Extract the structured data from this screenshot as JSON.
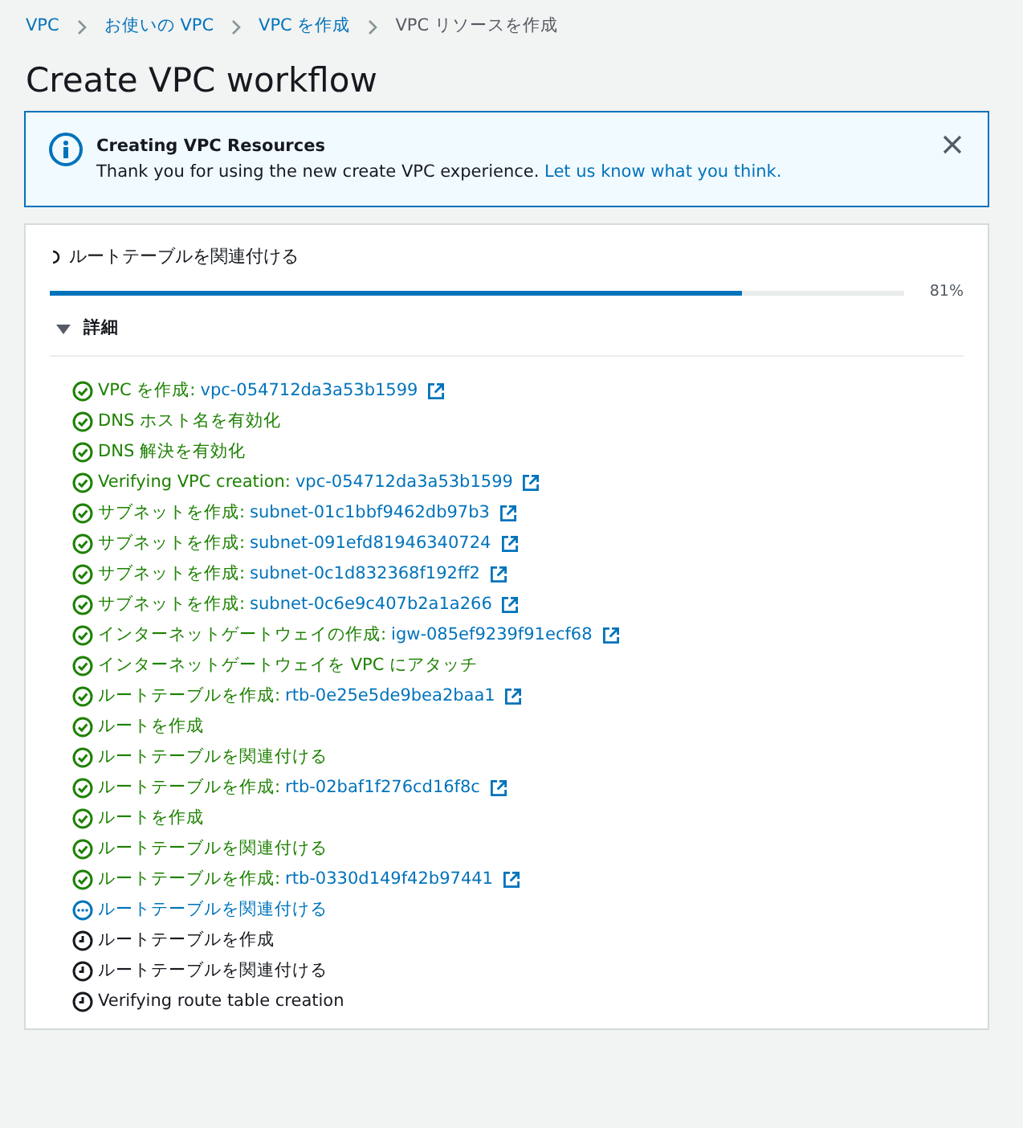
{
  "breadcrumbs": [
    {
      "label": "VPC",
      "current": false
    },
    {
      "label": "お使いの VPC",
      "current": false
    },
    {
      "label": "VPC を作成",
      "current": false
    },
    {
      "label": "VPC リソースを作成",
      "current": true
    }
  ],
  "title": "Create VPC workflow",
  "flash": {
    "title": "Creating VPC Resources",
    "message": "Thank you for using the new create VPC experience.",
    "link": "Let us know what you think."
  },
  "progress": {
    "status": "ルートテーブルを関連付ける",
    "level": 0.81,
    "reading": "81%"
  },
  "details": {
    "label": "詳細",
    "expanded": true,
    "steps": [
      {
        "kind": "success",
        "label": "VPC を作成:",
        "link": "vpc-054712da3a53b1599"
      },
      {
        "kind": "success",
        "label": "DNS ホスト名を有効化"
      },
      {
        "kind": "success",
        "label": "DNS 解決を有効化"
      },
      {
        "kind": "success",
        "label": "Verifying VPC creation:",
        "link": "vpc-054712da3a53b1599"
      },
      {
        "kind": "success",
        "label": "サブネットを作成:",
        "link": "subnet-01c1bbf9462db97b3"
      },
      {
        "kind": "success",
        "label": "サブネットを作成:",
        "link": "subnet-091efd81946340724"
      },
      {
        "kind": "success",
        "label": "サブネットを作成:",
        "link": "subnet-0c1d832368f192ff2"
      },
      {
        "kind": "success",
        "label": "サブネットを作成:",
        "link": "subnet-0c6e9c407b2a1a266"
      },
      {
        "kind": "success",
        "label": "インターネットゲートウェイの作成:",
        "link": "igw-085ef9239f91ecf68"
      },
      {
        "kind": "success",
        "label": "インターネットゲートウェイを VPC にアタッチ"
      },
      {
        "kind": "success",
        "label": "ルートテーブルを作成:",
        "link": "rtb-0e25e5de9bea2baa1"
      },
      {
        "kind": "success",
        "label": "ルートを作成"
      },
      {
        "kind": "success",
        "label": "ルートテーブルを関連付ける"
      },
      {
        "kind": "success",
        "label": "ルートテーブルを作成:",
        "link": "rtb-02baf1f276cd16f8c"
      },
      {
        "kind": "success",
        "label": "ルートを作成"
      },
      {
        "kind": "success",
        "label": "ルートテーブルを関連付ける"
      },
      {
        "kind": "success",
        "label": "ルートテーブルを作成:",
        "link": "rtb-0330d149f42b97441"
      },
      {
        "kind": "in-progress",
        "label": "ルートテーブルを関連付ける"
      },
      {
        "kind": "pending",
        "label": "ルートテーブルを作成"
      },
      {
        "kind": "pending",
        "label": "ルートテーブルを関連付ける"
      },
      {
        "kind": "pending",
        "label": "Verifying route table creation"
      }
    ]
  }
}
